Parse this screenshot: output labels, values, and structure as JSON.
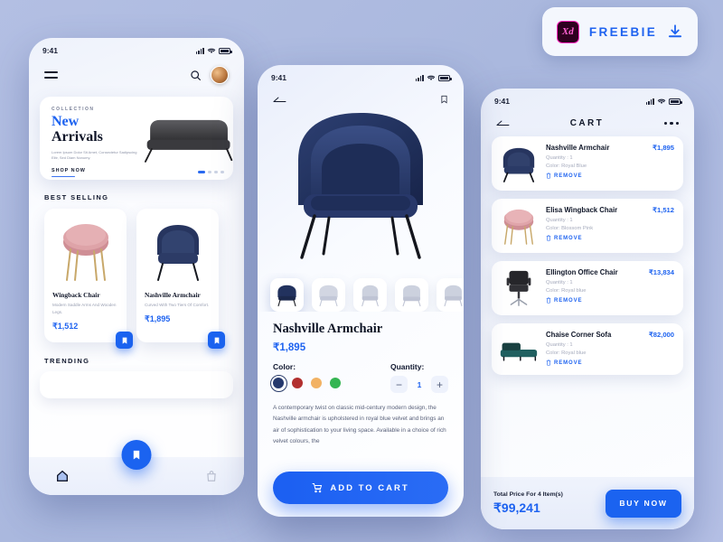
{
  "badge": {
    "logo_text": "Xd",
    "label": "FREEBIE",
    "download_icon": "download-icon"
  },
  "status_bar": {
    "time": "9:41"
  },
  "phone1": {
    "header": {
      "menu_icon": "hamburger-menu-icon",
      "search_icon": "search-icon",
      "avatar": "user-avatar"
    },
    "banner": {
      "eyebrow": "COLLECTION",
      "title_line1": "New",
      "title_line2": "Arrivals",
      "body": "Lorem Ipsum Dolor Sit Amet, Consectetur Sadipscing Elitr, Sed Diam Nonumy.",
      "cta": "SHOP NOW",
      "dots": 4,
      "active_dot": 0
    },
    "best_selling_title": "BEST SELLING",
    "products": [
      {
        "name": "Wingback Chair",
        "desc": "Modern Saddle Arms And Wooden Legs.",
        "price": "₹1,512",
        "color": "#d89aa0",
        "bookmark_icon": "bookmark-icon"
      },
      {
        "name": "Nashville Armchair",
        "desc": "Curved With Two Tiers Of Comfort.",
        "price": "₹1,895",
        "color": "#27355f",
        "bookmark_icon": "bookmark-icon"
      }
    ],
    "trending_title": "TRENDING",
    "tabbar": {
      "home_icon": "home-icon",
      "fab_icon": "bookmark-icon",
      "bag_icon": "shopping-bag-icon"
    }
  },
  "phone2": {
    "header": {
      "back_icon": "back-arrow-icon",
      "bookmark_icon": "bookmark-icon"
    },
    "thumbnails": [
      {
        "name": "thumbnail-1",
        "selected": true
      },
      {
        "name": "thumbnail-2",
        "selected": false
      },
      {
        "name": "thumbnail-3",
        "selected": false
      },
      {
        "name": "thumbnail-4",
        "selected": false
      },
      {
        "name": "thumbnail-5",
        "selected": false
      }
    ],
    "title": "Nashville Armchair",
    "price": "₹1,895",
    "color_label": "Color:",
    "colors": [
      {
        "hex": "#25386c",
        "selected": true
      },
      {
        "hex": "#b2302f",
        "selected": false
      },
      {
        "hex": "#f2b264",
        "selected": false
      },
      {
        "hex": "#35b552",
        "selected": false
      }
    ],
    "quantity_label": "Quantity:",
    "quantity_value": "1",
    "minus_label": "−",
    "plus_label": "+",
    "description": "A contemporary twist on classic mid-century modern design, the Nashville armchair is upholstered in royal blue velvet and brings an air of sophistication to your living space. Available in a choice of rich velvet colours, the",
    "cart_button": {
      "label": "ADD TO CART",
      "icon": "shopping-cart-icon"
    }
  },
  "phone3": {
    "header": {
      "back_icon": "back-arrow-icon",
      "title": "CART",
      "more_icon": "more-options-icon"
    },
    "items": [
      {
        "name": "Nashville Armchair",
        "price": "₹1,895",
        "quantity": "Quantity : 1",
        "color": "Color: Royal Blue",
        "remove": "REMOVE",
        "swatch": "#27355f"
      },
      {
        "name": "Elisa Wingback Chair",
        "price": "₹1,512",
        "quantity": "Quantity : 1",
        "color": "Color: Blossom Pink",
        "remove": "REMOVE",
        "swatch": "#d89aa0"
      },
      {
        "name": "Ellington Office Chair",
        "price": "₹13,834",
        "quantity": "Quantity : 1",
        "color": "Color: Royal blue",
        "remove": "REMOVE",
        "swatch": "#2b2b2f"
      },
      {
        "name": "Chaise Corner Sofa",
        "price": "₹82,000",
        "quantity": "Quantity : 1",
        "color": "Color: Royal blue",
        "remove": "REMOVE",
        "swatch": "#1d4a4a"
      }
    ],
    "footer": {
      "total_label": "Total Price For 4 Item(s)",
      "total_value": "₹99,241",
      "buy_label": "BUY NOW"
    }
  },
  "colors": {
    "accent": "#1b63f0",
    "background": "#b0bce1",
    "text_dark": "#0f1628"
  }
}
